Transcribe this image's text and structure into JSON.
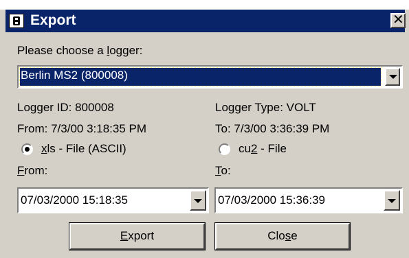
{
  "window": {
    "title": "Export",
    "icon": "logger-app-icon",
    "close_symbol": "✕"
  },
  "logger_select": {
    "prompt_pre": "Please choose a ",
    "prompt_accel": "l",
    "prompt_post": "ogger:",
    "value": "Berlin MS2 (800008)"
  },
  "info": {
    "logger_id": "Logger ID: 800008",
    "logger_type": "Logger Type: VOLT",
    "from": "From: 7/3/00 3:18:35 PM",
    "to": "To: 7/3/00 3:36:39 PM"
  },
  "format": {
    "selected": "xls",
    "xls_accel": "x",
    "xls_rest": "ls - File (ASCII)",
    "cu2_pre": "cu",
    "cu2_accel": "2",
    "cu2_post": " - File"
  },
  "range": {
    "from_accel": "F",
    "from_rest": "rom:",
    "to_accel": "T",
    "to_rest": "o:",
    "from_value": "07/03/2000 15:18:35",
    "to_value": "07/03/2000 15:36:39"
  },
  "buttons": {
    "export_accel": "E",
    "export_rest": "xport",
    "close_pre": "Clo",
    "close_accel": "s",
    "close_post": "e"
  },
  "colors": {
    "titlebar": "#0a246a",
    "face": "#d4d0c8",
    "selection": "#0a246a"
  }
}
